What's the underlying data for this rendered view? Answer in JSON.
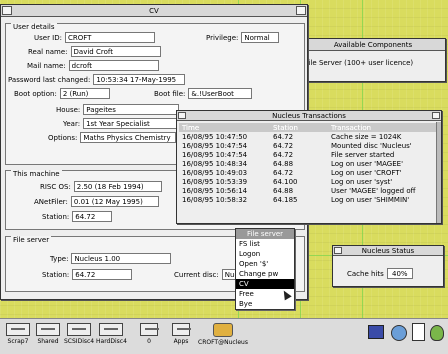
{
  "cv_window": {
    "title": "CV",
    "user_details": {
      "title": "User details",
      "user_id_label": "User ID:",
      "user_id": "CROFT",
      "privilege_label": "Privilege:",
      "privilege": "Normal",
      "real_name_label": "Real name:",
      "real_name": "David Croft",
      "mail_name_label": "Mail name:",
      "mail_name": "dcroft",
      "pw_changed_label": "Password last changed:",
      "pw_changed": "10:53:34 17-May-1995",
      "boot_option_label": "Boot option:",
      "boot_option": "2 (Run)",
      "boot_file_label": "Boot file:",
      "boot_file": "&.!UserBoot",
      "house_label": "House:",
      "house": "Pageites",
      "year_label": "Year:",
      "year": "1st Year Specialist",
      "options_label": "Options:",
      "options": "Maths Physics Chemistry"
    },
    "this_machine": {
      "title": "This machine",
      "risc_os_label": "RISC OS:",
      "risc_os": "2.50 (18 Feb 1994)",
      "anetfiler_label": "ANetFiler:",
      "anetfiler": "0.01 (12 May 1995)",
      "station_label": "Station:",
      "station": "64.72"
    },
    "file_server": {
      "title": "File server",
      "type_label": "Type:",
      "type": "Nucleus 1.00",
      "station_label": "Station:",
      "station": "64.72",
      "current_disc_label": "Current disc:",
      "current_disc": "Nucleus"
    }
  },
  "available_components": {
    "title": "Available Components",
    "item": "File Server (100+ user licence)"
  },
  "transactions": {
    "title": "Nucleus Transactions",
    "headers": [
      "Time",
      "Station",
      "Transaction"
    ],
    "rows": [
      [
        "16/08/95 10:47:50",
        "64.72",
        "Cache size = 1024K"
      ],
      [
        "16/08/95 10:47:54",
        "64.72",
        "Mounted disc 'Nucleus'"
      ],
      [
        "16/08/95 10:47:54",
        "64.72",
        "File server started"
      ],
      [
        "16/08/95 10:48:34",
        "64.88",
        "Log on user 'MAGEE'"
      ],
      [
        "16/08/95 10:49:03",
        "64.72",
        "Log on user 'CROFT'"
      ],
      [
        "16/08/95 10:53:39",
        "64.100",
        "Log on user 'syst'"
      ],
      [
        "16/08/95 10:56:14",
        "64.88",
        "User 'MAGEE' logged off"
      ],
      [
        "16/08/95 10:58:32",
        "64.185",
        "Log on user 'SHIMMIN'"
      ]
    ]
  },
  "file_server_menu": {
    "title": "File server",
    "items": [
      "FS list",
      "Logon",
      "Open '$'",
      "Change pw",
      "CV",
      "Free",
      "Bye"
    ]
  },
  "nucleus_status": {
    "title": "Nucleus Status",
    "cache_hits_label": "Cache hits",
    "cache_hits": "40%"
  },
  "iconbar": {
    "items": [
      "Scrap7",
      "Shared",
      "SCSIDisc4",
      "HardDisc4",
      "0",
      "Apps",
      "CROFT@Nucleus"
    ]
  }
}
